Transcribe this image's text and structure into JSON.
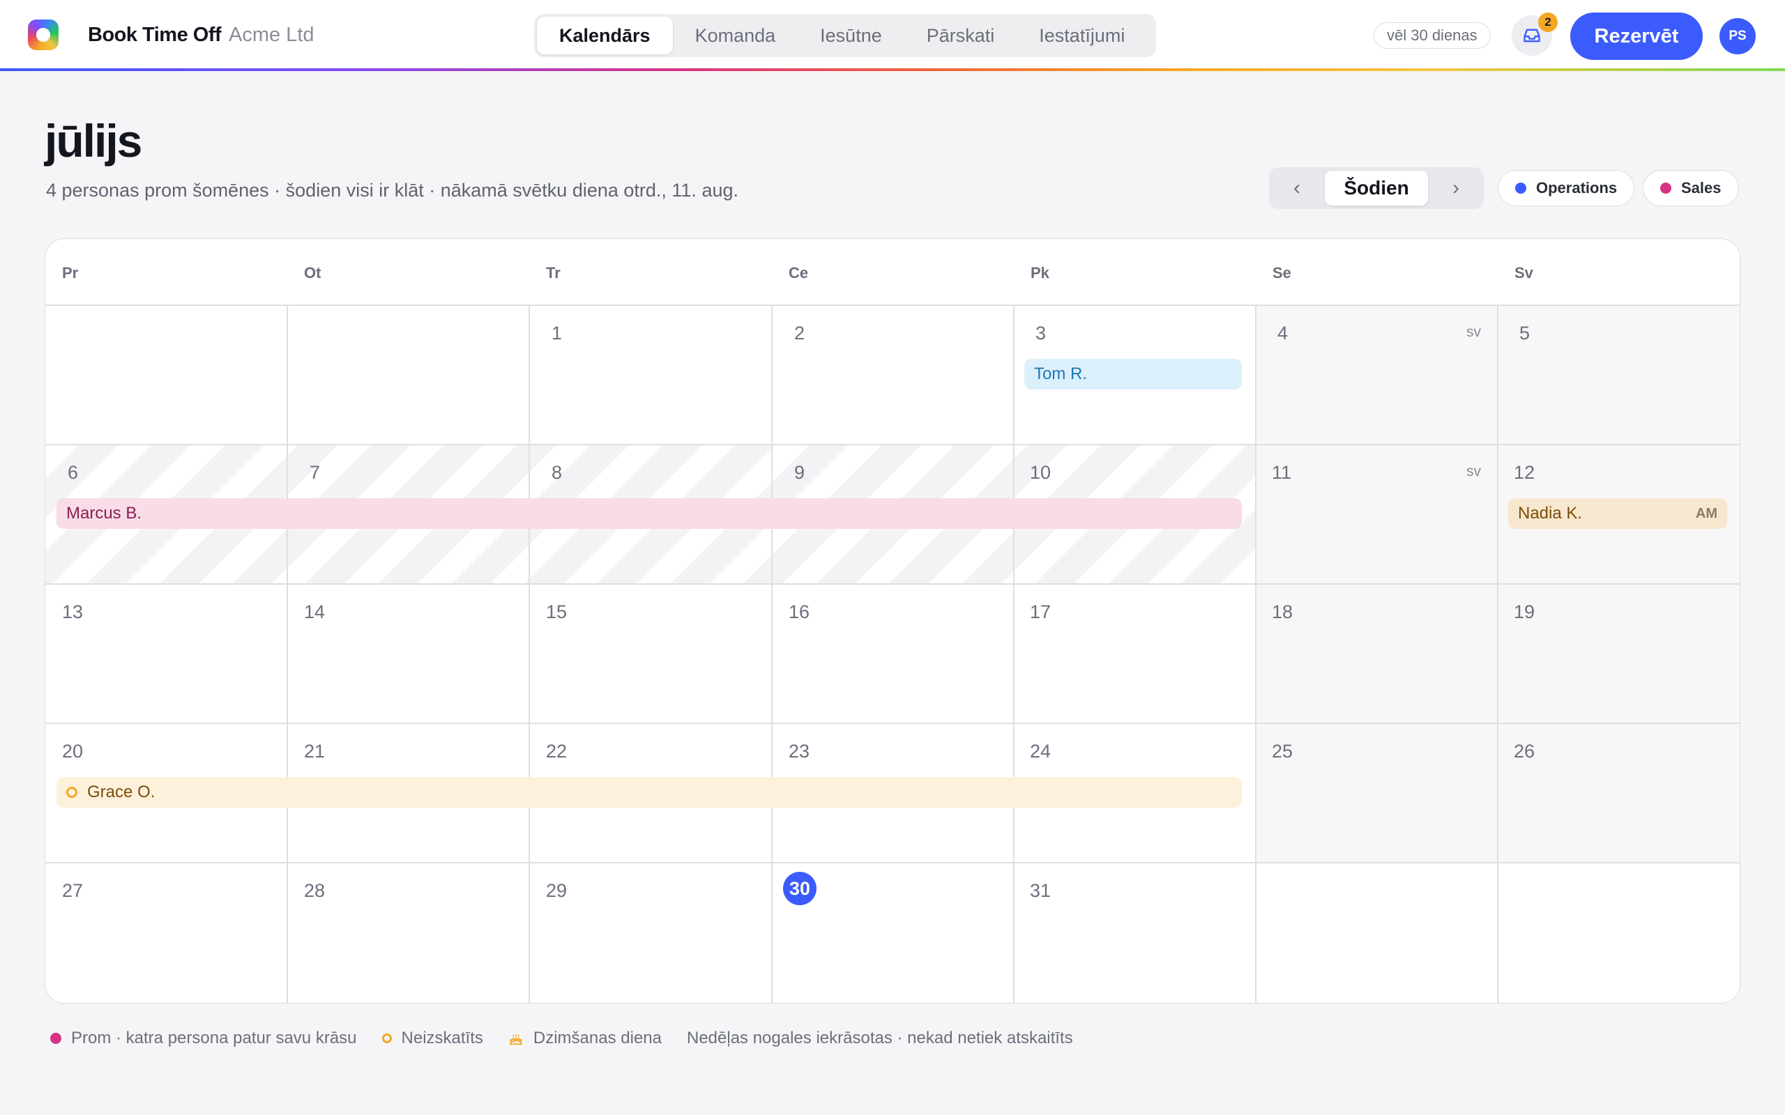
{
  "app": {
    "brand": "Book Time Off",
    "org": "Acme Ltd"
  },
  "nav": {
    "tabs": [
      {
        "label": "Kalendārs",
        "active": true
      },
      {
        "label": "Komanda"
      },
      {
        "label": "Iesūtne"
      },
      {
        "label": "Pārskati"
      },
      {
        "label": "Iestatījumi"
      }
    ]
  },
  "header": {
    "days_left": "vēl 30 dienas",
    "inbox_badge": "2",
    "book_label": "Rezervēt",
    "avatar_initials": "PS"
  },
  "page": {
    "title": "jūlijs",
    "subtitle": "4 personas prom šomēnes · šodien visi ir klāt · nākamā svētku diena otrd., 11. aug.",
    "prev": "‹",
    "today": "Šodien",
    "next": "›"
  },
  "filters": [
    {
      "label": "Operations",
      "color": "#3b5bfd"
    },
    {
      "label": "Sales",
      "color": "#d63384"
    }
  ],
  "calendar": {
    "weekdays": [
      "Pr",
      "Ot",
      "Tr",
      "Ce",
      "Pk",
      "Se",
      "Sv"
    ],
    "weeks": [
      [
        "",
        "",
        "1",
        "2",
        "3",
        "4",
        "5"
      ],
      [
        "6",
        "7",
        "8",
        "9",
        "10",
        "11",
        "12"
      ],
      [
        "13",
        "14",
        "15",
        "16",
        "17",
        "18",
        "19"
      ],
      [
        "20",
        "21",
        "22",
        "23",
        "24",
        "25",
        "26"
      ],
      [
        "27",
        "28",
        "29",
        "30",
        "31",
        "",
        ""
      ]
    ],
    "today": "30",
    "holiday_tag": "sv",
    "events": {
      "tom": "Tom R.",
      "marcus": "Marcus B.",
      "nadia": "Nadia K.",
      "nadia_half": "AM",
      "grace": "Grace O."
    }
  },
  "legend": {
    "away": "Prom · katra persona patur savu krāsu",
    "pending": "Neizskatīts",
    "birthday": "Dzimšanas diena",
    "weekends": "Nedēļas nogales iekrāsotas · nekad netiek atskaitīts"
  },
  "colors": {
    "accent": "#3b5bfd",
    "away": "#d63384",
    "pending": "#f5a623"
  }
}
